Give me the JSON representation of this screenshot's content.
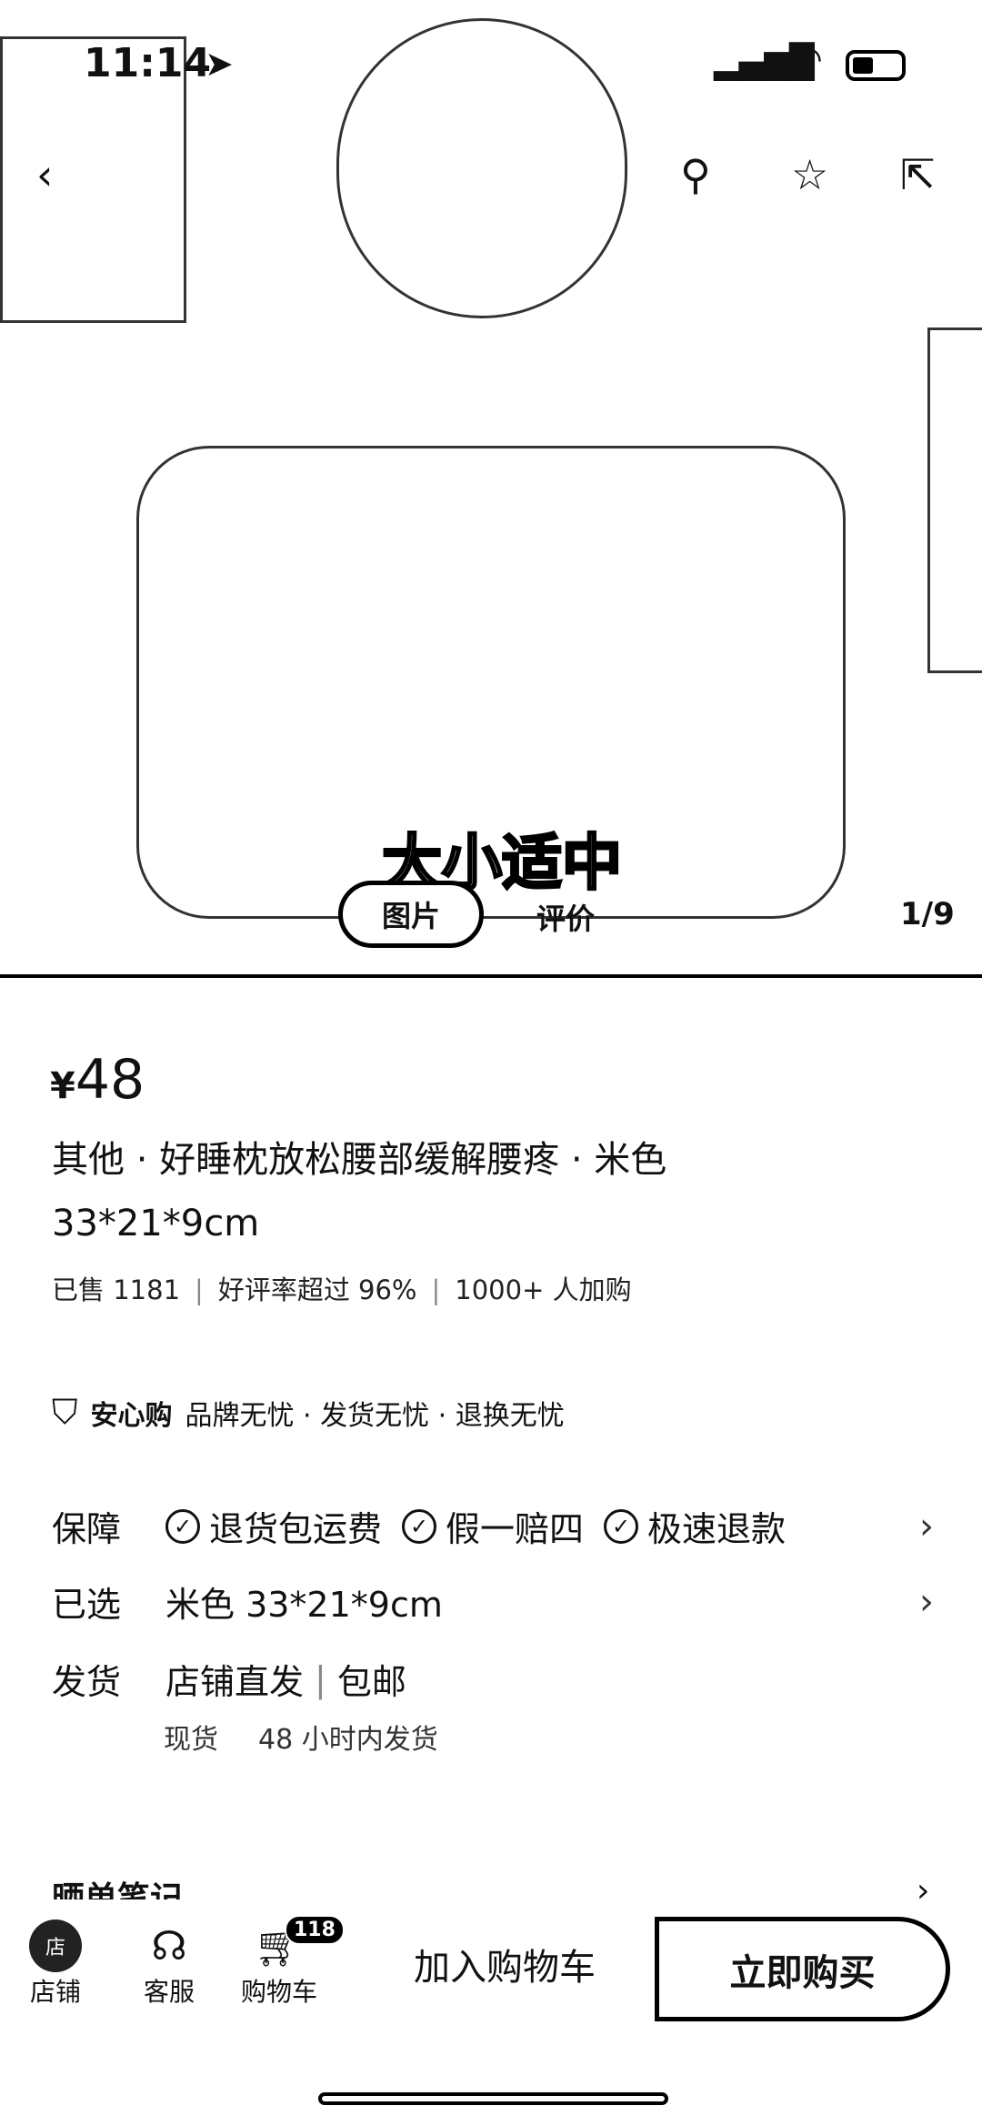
{
  "status_bar": {
    "time": "11:14"
  },
  "gallery": {
    "caption": "大小适中",
    "tabs": [
      "图片",
      "评价"
    ],
    "counter": "1/9"
  },
  "product": {
    "currency": "¥",
    "price": "48",
    "title_line1": "其他 · 好睡枕放松腰部缓解腰疼 · 米色",
    "title_line2": "33*21*9cm",
    "stats": [
      "已售 1181",
      "好评率超过 96%",
      "1000+ 人加购"
    ]
  },
  "assurance": {
    "name": "安心购",
    "desc": "品牌无忧 · 发货无忧 · 退换无忧"
  },
  "guarantee": {
    "label": "保障",
    "items": [
      "退货包运费",
      "假一赔四",
      "极速退款"
    ]
  },
  "selected": {
    "label": "已选",
    "value": "米色 33*21*9cm"
  },
  "shipping": {
    "label": "发货",
    "value": "店铺直发",
    "extra": "包邮",
    "stock": "现货",
    "time": "48 小时内发货"
  },
  "notes": {
    "label": "晒单笔记"
  },
  "bottom_bar": {
    "shop": "店铺",
    "service": "客服",
    "cart": "购物车",
    "cart_count": "118",
    "add_to_cart": "加入购物车",
    "buy_now": "立即购买"
  }
}
